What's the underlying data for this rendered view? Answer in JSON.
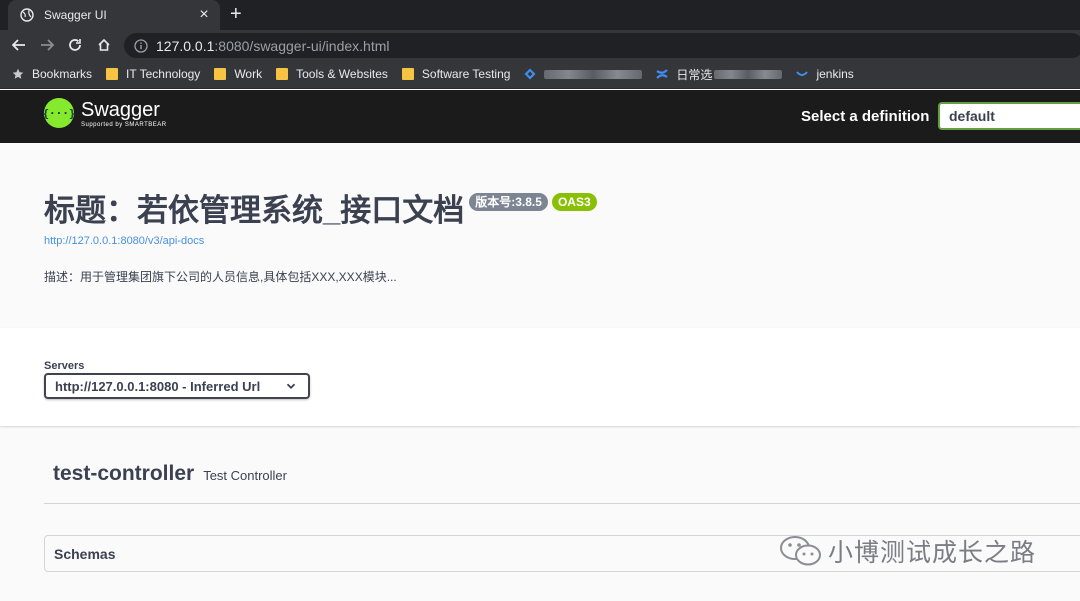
{
  "browser": {
    "tab_title": "Swagger UI",
    "tab_close": "×",
    "new_tab": "+",
    "url_host": "127.0.0.1",
    "url_rest": ":8080/swagger-ui/index.html",
    "bookmarks": [
      {
        "label": "Bookmarks",
        "icon": "star-icon"
      },
      {
        "label": "IT Technology",
        "icon": "folder-icon"
      },
      {
        "label": "Work",
        "icon": "folder-icon"
      },
      {
        "label": "Tools & Websites",
        "icon": "folder-icon"
      },
      {
        "label": "Software Testing",
        "icon": "folder-icon"
      },
      {
        "label": "日常选",
        "icon": "confluence-icon"
      },
      {
        "label": "jenkins",
        "icon": "jenkins-icon"
      }
    ]
  },
  "swagger": {
    "brand": "Swagger",
    "brand_sub": "Supported by SMARTBEAR",
    "logo_glyph": "{···}",
    "select_label": "Select a definition",
    "select_value": "default"
  },
  "info": {
    "title": "标题：若依管理系统_接口文档",
    "version_badge": "版本号:3.8.5",
    "oas_badge": "OAS3",
    "link": "http://127.0.0.1:8080/v3/api-docs",
    "description": "描述：用于管理集团旗下公司的人员信息,具体包括XXX,XXX模块..."
  },
  "servers": {
    "label": "Servers",
    "selected": "http://127.0.0.1:8080 - Inferred Url"
  },
  "tag": {
    "name": "test-controller",
    "description": "Test Controller"
  },
  "schemas": {
    "label": "Schemas"
  },
  "watermark": {
    "text": "小博测试成长之路"
  },
  "colors": {
    "swagger_green": "#85ea2d",
    "topbar": "#1b1b1b",
    "oas_badge": "#89bf04",
    "version_badge": "#7d8492",
    "link": "#4990e2",
    "text": "#3b4151"
  }
}
